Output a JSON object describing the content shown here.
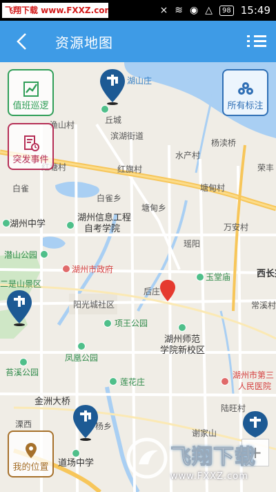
{
  "status_bar": {
    "watermark": "飞翔下载 www.FXXZ.com",
    "battery": "98",
    "time": "15:49"
  },
  "header": {
    "title": "资源地图"
  },
  "buttons": {
    "duty_patrol": "值班巡逻",
    "all_markers": "所有标注",
    "emergency": "突发事件",
    "my_location": "我的位置"
  },
  "map_labels": {
    "hushanzhuang": "湖山庄",
    "qiucheng": "丘城",
    "yushancun": "渔山村",
    "binhujiedao": "滨湖街道",
    "yangjiaqiao": "杨渎桥",
    "shuipingzhuang": "水产村",
    "hongtangcun": "红塘村",
    "hongqi": "红旗村",
    "ronglin": "荣丰",
    "baique": "白雀",
    "baiquexiang": "白雀乡",
    "tangdianxiang": "塘甸乡",
    "tangdiancun": "塘甸村",
    "wananciao": "万安村",
    "huzhou_zhongxue": "湖州中学",
    "huzhou_xinxi": "湖州信息工程",
    "zikao": "自考学院",
    "xuyan": "瑶阳",
    "qianshan_park": "潜山公园",
    "gov": "湖州市政府",
    "yutang": "玉堂庙",
    "xichang": "西长兴",
    "erlong": "二是山景区",
    "houzhuang": "后庄",
    "changkouqiao": "常溪村",
    "yangguang": "阳光城社区",
    "xiangwang": "项王公园",
    "huzhou_normal": "湖州师范",
    "xinxiaoqu": "学院新校区",
    "fenghuang": "凤凰公园",
    "zhuxi": "苔溪公园",
    "lianhua": "莲花庄",
    "hospital": "湖州市第三人民医院",
    "hospital_1": "湖州市第三",
    "hospital_2": "人民医院",
    "jinzhou": "金洲大桥",
    "luzhuang": "陆旺村",
    "daochang": "道场中学",
    "xieshan": "谢家山",
    "yangzhuang": "杨乡",
    "luoxi": "溧西",
    "hushan": "湖山"
  },
  "watermark_bottom": {
    "brand": "飞翔下载",
    "url": "www.FXXZ.com"
  },
  "colors": {
    "header_bg": "#3e9be6",
    "water": "#a9cff3",
    "green_btn": "#2f9e57",
    "blue_btn": "#2f6fb5",
    "red_btn": "#b52d55",
    "brown_btn": "#a6702a",
    "main_road": "#f7c65a",
    "pin_red": "#e53a2f",
    "pin_blue": "#1d5a94"
  },
  "icons": {
    "back": "chevron-left-icon",
    "menu": "list-menu-icon",
    "duty_patrol": "patrol-chart-icon",
    "all_markers": "markers-cluster-icon",
    "emergency": "clipboard-clock-icon",
    "my_location": "location-pin-icon",
    "zoom_in": "plus-icon"
  }
}
